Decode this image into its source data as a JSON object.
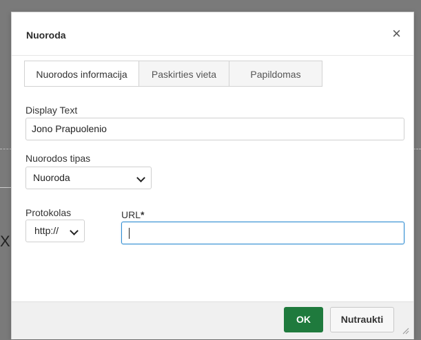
{
  "dialog": {
    "title": "Nuoroda",
    "close_icon": "close-icon",
    "tabs": [
      {
        "label": "Nuorodos informacija",
        "active": true
      },
      {
        "label": "Paskirties vieta",
        "active": false
      },
      {
        "label": "Papildomas",
        "active": false
      }
    ],
    "display_text": {
      "label": "Display Text",
      "value": "Jono Prapuolenio"
    },
    "link_type": {
      "label": "Nuorodos tipas",
      "selected": "Nuoroda"
    },
    "protocol": {
      "label": "Protokolas",
      "selected": "http://"
    },
    "url": {
      "label": "URL",
      "required_mark": "*",
      "value": ""
    },
    "footer": {
      "ok_label": "OK",
      "cancel_label": "Nutraukti"
    }
  },
  "background": {
    "glyph": "X"
  },
  "colors": {
    "ok_button": "#1f7a3d",
    "focus_border": "#2d8bd2"
  }
}
